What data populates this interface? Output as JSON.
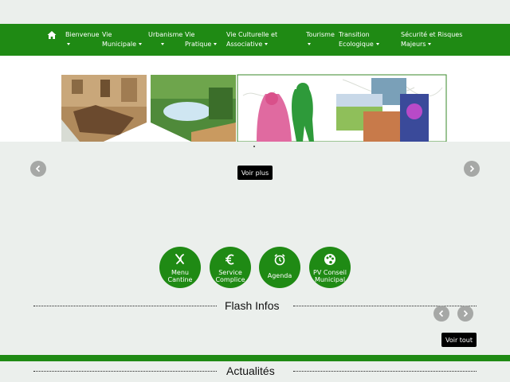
{
  "nav": {
    "items": [
      {
        "label1": "Bienvenue",
        "label2": ""
      },
      {
        "label1": "Vie",
        "label2": "Municipale"
      },
      {
        "label1": "Urbanisme",
        "label2": ""
      },
      {
        "label1": "Vie",
        "label2": "Pratique"
      },
      {
        "label1": "Vie Culturelle et",
        "label2": "Associative"
      },
      {
        "label1": "Tourisme",
        "label2": ""
      },
      {
        "label1": "Transition",
        "label2": "Ecologique"
      },
      {
        "label1": "Sécurité et Risques",
        "label2": "Majeurs"
      }
    ]
  },
  "slider": {
    "voir_plus": "Voir plus"
  },
  "quick_links": [
    {
      "label1": "Menu",
      "label2": "Cantine",
      "icon": "utensils-icon"
    },
    {
      "label1": "Service",
      "label2": "Complice",
      "icon": "euro-icon"
    },
    {
      "label1": "Agenda",
      "label2": "",
      "icon": "alarm-clock-icon"
    },
    {
      "label1": "PV Conseil",
      "label2": "Municipal",
      "icon": "palette-icon"
    }
  ],
  "flash": {
    "title": "Flash Infos",
    "voir_tout": "Voir tout"
  },
  "actus": {
    "title": "Actualités"
  },
  "colors": {
    "brand_green": "#1f8a14",
    "background": "#ebefec",
    "button_black": "#000000"
  }
}
